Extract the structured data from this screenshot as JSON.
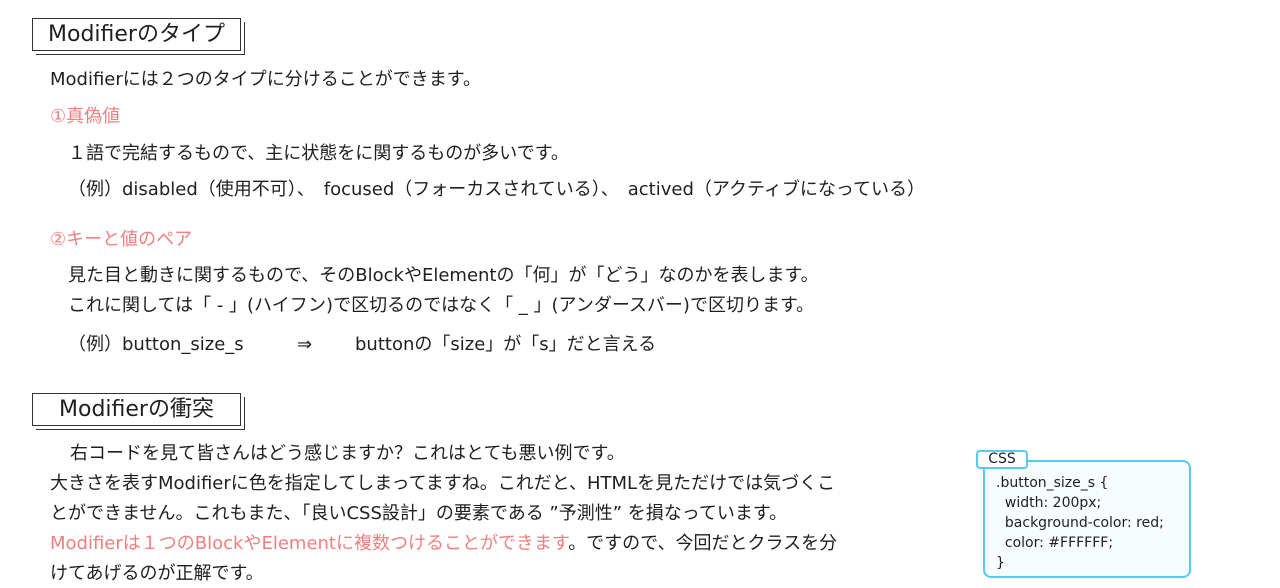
{
  "section1": {
    "heading": "Modifierのタイプ",
    "intro": "Modifierには２つのタイプに分けることができます。",
    "type1": {
      "title": "①真偽値",
      "description": "１語で完結するもので、主に状態をに関するものが多いです。",
      "example": "（例）disabled（使用不可）、　focused（フォーカスされている）、　actived（アクティブになっている）"
    },
    "type2": {
      "title": "②キーと値のペア",
      "description1": "見た目と動きに関するもので、そのBlockやElementの「何」が「どう」なのかを表します。",
      "description2": "これに関しては「 - 」(ハイフン)で区切るのではなく「 _ 」(アンダースバー)で区切ります。",
      "example_code": "（例）button_size_s",
      "example_arrow": "⇒",
      "example_meaning": "buttonの「size」が「s」だと言える"
    }
  },
  "section2": {
    "heading": "Modifierの衝突",
    "paragraph_line1": "右コードを見て皆さんはどう感じますか？これはとても悪い例です。",
    "paragraph_line2": "大きさを表すModifierに色を指定してしまってますね。これだと、HTMLを見ただけでは気づくこ",
    "paragraph_line3": "とができません。これもまた、「良いCSS設計」の要素である ”予測性” を損なっています。",
    "paragraph_line4_highlight": "Modifierは１つのBlockやElementに複数つけることができます",
    "paragraph_line4_rest": "。ですので、今回だとクラスを分",
    "paragraph_line5": "けてあげるのが正解です。"
  },
  "code_sample": {
    "label": "CSS",
    "lines": [
      ".button_size_s {",
      "  width: 200px;",
      "  background-color: red;",
      "  color: #FFFFFF;",
      "}"
    ]
  },
  "colors": {
    "accent": "#f08080",
    "code_border": "#5bc8f0",
    "text": "#1f1f1f"
  }
}
